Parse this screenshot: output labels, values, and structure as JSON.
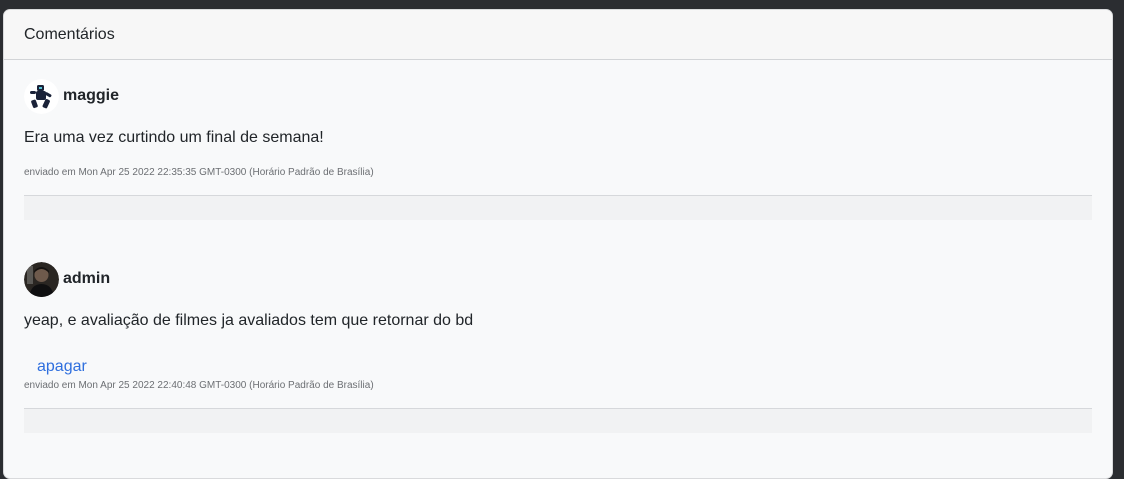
{
  "card": {
    "title": "Comentários"
  },
  "comments": [
    {
      "username": "maggie",
      "avatar_icon": "robot-avatar-icon",
      "text": "Era uma vez curtindo um final de semana!",
      "sent": "enviado em Mon Apr 25 2022 22:35:35 GMT-0300 (Horário Padrão de Brasília)"
    },
    {
      "username": "admin",
      "avatar_icon": "person-photo-avatar",
      "text": "yeap, e avaliação de filmes ja avaliados tem que retornar do bd",
      "delete_label": "apagar",
      "sent": "enviado em Mon Apr 25 2022 22:40:48 GMT-0300 (Horário Padrão de Brasília)"
    }
  ],
  "colors": {
    "link": "#2f6fde",
    "card_bg": "#f8f9fa",
    "page_bg": "#2b2d31"
  }
}
